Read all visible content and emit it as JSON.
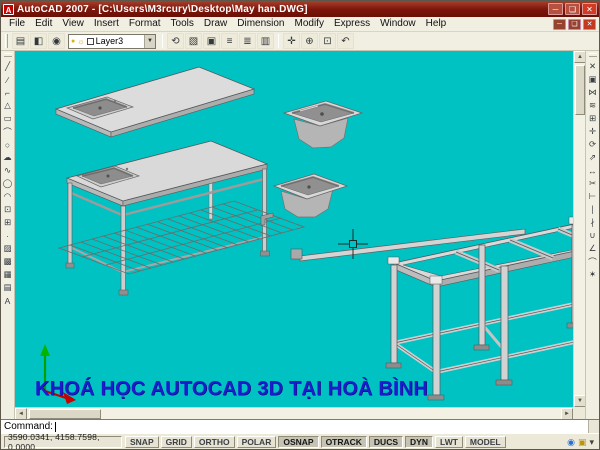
{
  "window": {
    "title": "AutoCAD 2007 - [C:\\Users\\M3rcury\\Desktop\\May han.DWG]",
    "controls": {
      "minimize": "─",
      "maximize": "❏",
      "close": "✕"
    }
  },
  "menu": {
    "items": [
      "File",
      "Edit",
      "View",
      "Insert",
      "Format",
      "Tools",
      "Draw",
      "Dimension",
      "Modify",
      "Express",
      "Window",
      "Help"
    ],
    "doc_controls": {
      "minimize": "─",
      "restore": "❏",
      "close": "✕"
    }
  },
  "toolbar": {
    "group1": [
      {
        "name": "layer-properties-manager",
        "glyph": "▤"
      },
      {
        "name": "layer-states-manager",
        "glyph": "◧"
      },
      {
        "name": "make-object-layer-current",
        "glyph": "◉"
      }
    ],
    "layer_dropdown": {
      "bulb_glyph": "●",
      "sun_glyph": "☼",
      "value": "Layer3",
      "arrow_glyph": "▼"
    },
    "group2": [
      {
        "name": "layer-previous",
        "glyph": "⟲"
      },
      {
        "name": "match-properties",
        "glyph": "▧"
      },
      {
        "name": "color-control",
        "glyph": "▣"
      },
      {
        "name": "linetype-control",
        "glyph": "≡"
      },
      {
        "name": "lineweight-control",
        "glyph": "≣"
      },
      {
        "name": "plot-style-control",
        "glyph": "▥"
      }
    ],
    "group3": [
      {
        "name": "pan-realtime",
        "glyph": "✛"
      },
      {
        "name": "zoom-realtime",
        "glyph": "⊕"
      },
      {
        "name": "zoom-window",
        "glyph": "⊡"
      },
      {
        "name": "zoom-previous",
        "glyph": "↶"
      }
    ]
  },
  "palettes": {
    "draw": [
      {
        "name": "line",
        "glyph": "╱"
      },
      {
        "name": "construction-line",
        "glyph": "∕"
      },
      {
        "name": "polyline",
        "glyph": "⌐"
      },
      {
        "name": "polygon",
        "glyph": "△"
      },
      {
        "name": "rectangle",
        "glyph": "▭"
      },
      {
        "name": "arc",
        "glyph": "⌒"
      },
      {
        "name": "circle",
        "glyph": "○"
      },
      {
        "name": "revision-cloud",
        "glyph": "☁"
      },
      {
        "name": "spline",
        "glyph": "∿"
      },
      {
        "name": "ellipse",
        "glyph": "◯"
      },
      {
        "name": "ellipse-arc",
        "glyph": "◠"
      },
      {
        "name": "insert-block",
        "glyph": "⊡"
      },
      {
        "name": "make-block",
        "glyph": "⊞"
      },
      {
        "name": "point",
        "glyph": "∙"
      },
      {
        "name": "hatch",
        "glyph": "▨"
      },
      {
        "name": "gradient",
        "glyph": "▩"
      },
      {
        "name": "region",
        "glyph": "▦"
      },
      {
        "name": "table",
        "glyph": "▤"
      },
      {
        "name": "multiline-text",
        "glyph": "A"
      }
    ],
    "modify": [
      {
        "name": "erase",
        "glyph": "✕"
      },
      {
        "name": "copy",
        "glyph": "▣"
      },
      {
        "name": "mirror",
        "glyph": "⋈"
      },
      {
        "name": "offset",
        "glyph": "≋"
      },
      {
        "name": "array",
        "glyph": "⊞"
      },
      {
        "name": "move",
        "glyph": "✛"
      },
      {
        "name": "rotate",
        "glyph": "⟳"
      },
      {
        "name": "scale",
        "glyph": "⇗"
      },
      {
        "name": "stretch",
        "glyph": "↔"
      },
      {
        "name": "trim",
        "glyph": "✂"
      },
      {
        "name": "extend",
        "glyph": "⊢"
      },
      {
        "name": "break-at-point",
        "glyph": "∣"
      },
      {
        "name": "break",
        "glyph": "∤"
      },
      {
        "name": "join",
        "glyph": "∪"
      },
      {
        "name": "chamfer",
        "glyph": "∠"
      },
      {
        "name": "fillet",
        "glyph": "⌒"
      },
      {
        "name": "explode",
        "glyph": "✶"
      }
    ]
  },
  "canvas": {
    "background": "#00c2c2"
  },
  "overlay": {
    "text": "KHOÁ HỌC AUTOCAD 3D TẠI HOÀ BÌNH",
    "color": "#1c1ccd"
  },
  "command": {
    "prompt": "Command:"
  },
  "statusbar": {
    "coords": "3590.0341, 4158.7598, 0.0000",
    "buttons": [
      {
        "label": "SNAP",
        "pressed": false
      },
      {
        "label": "GRID",
        "pressed": false
      },
      {
        "label": "ORTHO",
        "pressed": false
      },
      {
        "label": "POLAR",
        "pressed": false
      },
      {
        "label": "OSNAP",
        "pressed": true
      },
      {
        "label": "OTRACK",
        "pressed": true
      },
      {
        "label": "DUCS",
        "pressed": true
      },
      {
        "label": "DYN",
        "pressed": true
      },
      {
        "label": "LWT",
        "pressed": false
      },
      {
        "label": "MODEL",
        "pressed": false
      }
    ],
    "tray": [
      {
        "name": "communication-center-icon",
        "glyph": "◉",
        "color": "#2b6fd6"
      },
      {
        "name": "toolbar-lock-icon",
        "glyph": "▣",
        "color": "#b8960f"
      },
      {
        "name": "tray-menu-arrow-icon",
        "glyph": "▾",
        "color": "#44403a"
      }
    ]
  },
  "colors": {
    "titlebar": "#7c150a",
    "canvas": "#00c2c2",
    "overlay_blue": "#1c1ccd"
  }
}
